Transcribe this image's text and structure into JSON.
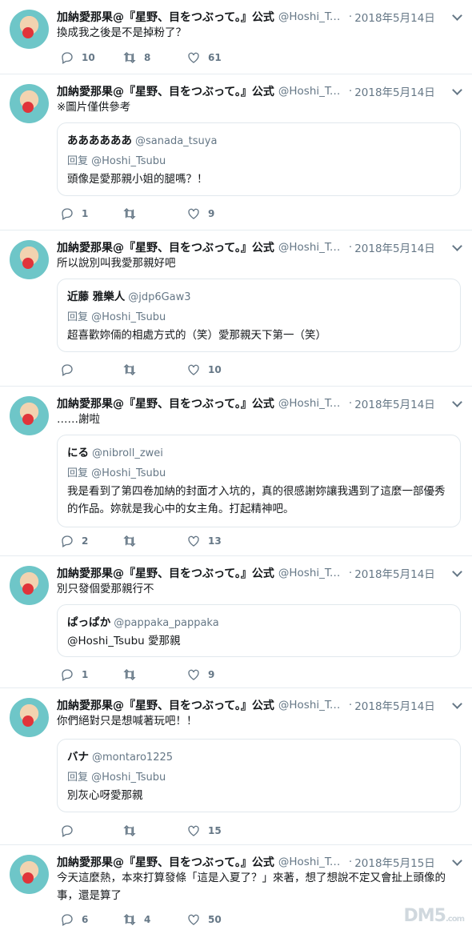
{
  "author": {
    "name": "加納愛那果@『星野、目をつぶって。』公式",
    "handle": "@Hoshi_Tsu..."
  },
  "tweets": [
    {
      "date": "2018年5月14日",
      "text": "換成我之後是不是掉粉了？",
      "quote": null,
      "counts": {
        "reply": "10",
        "retweet": "8",
        "like": "61"
      }
    },
    {
      "date": "2018年5月14日",
      "text": "※圖片僅供參考",
      "quote": {
        "name": "ああああああ",
        "handle": "@sanada_tsuya",
        "reply": "回复 @Hoshi_Tsubu",
        "text": "頭像是愛那親小姐的腿嗎？！"
      },
      "counts": {
        "reply": "1",
        "retweet": "",
        "like": "9"
      }
    },
    {
      "date": "2018年5月14日",
      "text": "所以說別叫我愛那親好吧",
      "quote": {
        "name": "近藤 雅樂人",
        "handle": "@jdp6Gaw3",
        "reply": "回复 @Hoshi_Tsubu",
        "text": "超喜歡妳倆的相處方式的（笑）愛那親天下第一（笑）"
      },
      "counts": {
        "reply": "",
        "retweet": "",
        "like": "10"
      }
    },
    {
      "date": "2018年5月14日",
      "text": "……謝啦",
      "quote": {
        "name": "にる",
        "handle": "@nibroll_zwei",
        "reply": "回复 @Hoshi_Tsubu",
        "text": "我是看到了第四卷加納的封面才入坑的，真的很感謝妳讓我遇到了這麼一部優秀的作品。妳就是我心中的女主角。打起精神吧。"
      },
      "counts": {
        "reply": "2",
        "retweet": "",
        "like": "13"
      }
    },
    {
      "date": "2018年5月14日",
      "text": "別只發個愛那親行不",
      "quote": {
        "name": "ぱっぱか",
        "handle": "@pappaka_pappaka",
        "reply": "",
        "text": "@Hoshi_Tsubu 愛那親"
      },
      "counts": {
        "reply": "1",
        "retweet": "",
        "like": "9"
      }
    },
    {
      "date": "2018年5月14日",
      "text": "你們絕對只是想喊著玩吧！！",
      "quote": {
        "name": "バナ",
        "handle": "@montaro1225",
        "reply": "回复 @Hoshi_Tsubu",
        "text": "別灰心呀愛那親"
      },
      "counts": {
        "reply": "",
        "retweet": "",
        "like": "15"
      }
    },
    {
      "date": "2018年5月15日",
      "text": "今天這麼熱，本來打算發條「這是入夏了？」來著，想了想說不定又會扯上頭像的事，還是算了",
      "quote": null,
      "counts": {
        "reply": "6",
        "retweet": "4",
        "like": "50"
      }
    }
  ],
  "watermark": {
    "main": "DM5",
    "suffix": ".com"
  },
  "icons": {
    "reply": "reply-icon",
    "retweet": "retweet-icon",
    "like": "heart-icon",
    "caret": "chevron-down-icon"
  },
  "colors": {
    "text": "#14171a",
    "muted": "#657786",
    "border": "#e6ecf0"
  }
}
